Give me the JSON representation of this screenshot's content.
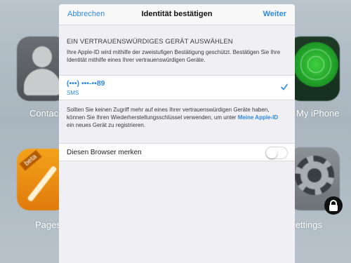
{
  "background": {
    "apps": [
      {
        "label": "Contac",
        "icon": "contacts-icon"
      },
      {
        "label": "My iPhone",
        "icon": "find-my-iphone-icon"
      },
      {
        "label": "Pages",
        "icon": "pages-icon",
        "badge": "beta"
      },
      {
        "label": "Settings",
        "icon": "settings-gear-icon"
      }
    ],
    "lock_icon": "lock-icon"
  },
  "modal": {
    "navbar": {
      "cancel_label": "Abbrechen",
      "title": "Identität bestätigen",
      "next_label": "Weiter"
    },
    "section_header": "EIN VERTRAUENSWÜRDIGES GERÄT AUSWÄHLEN",
    "section_description": "Ihre Apple-ID wird mithilfe der zweistufigen Bestätigung geschützt. Bestätigen Sie Ihre Identität mithilfe eines Ihrer vertrauenswürdigen Geräte.",
    "device": {
      "number": "(•••) •••-••89",
      "type": "SMS",
      "selected": true
    },
    "footer": {
      "text_before_link": "Sollten Sie keinen Zugriff mehr auf eines Ihrer vertrauenswürdigen Geräte haben, können Sie Ihren Wiederherstellungsschlüssel verwenden, um unter ",
      "link": "Meine Apple-ID",
      "text_after_link": " ein neues Gerät zu registrieren."
    },
    "remember": {
      "label": "Diesen Browser merken",
      "enabled": false
    }
  },
  "colors": {
    "accent": "#2f8ae4",
    "sheet_background": "#efeff4"
  }
}
